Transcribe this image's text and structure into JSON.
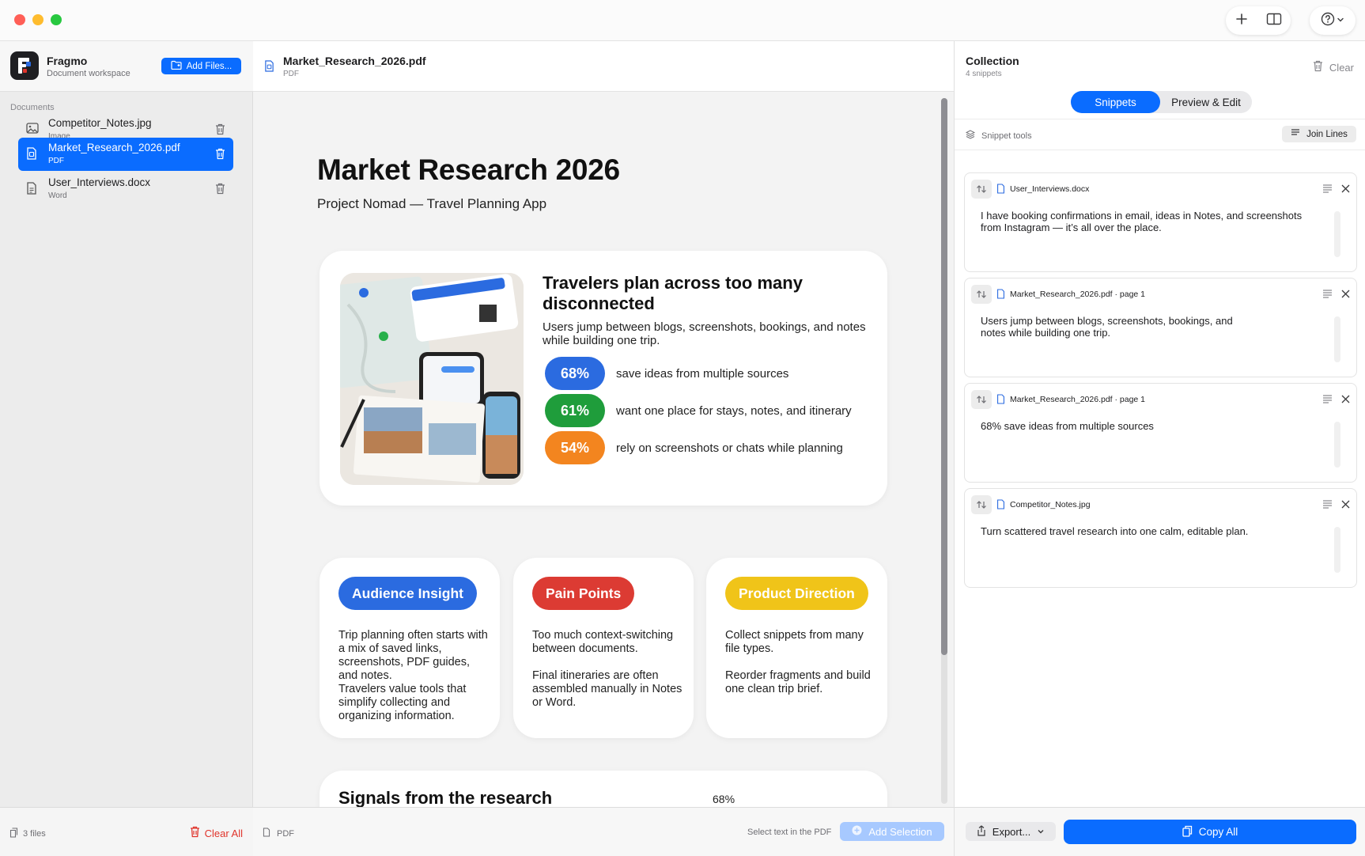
{
  "app": {
    "name": "Fragmo",
    "subtitle": "Document workspace",
    "add_files_label": "Add Files..."
  },
  "sidebar": {
    "section_label": "Documents",
    "documents": [
      {
        "name": "Competitor_Notes.jpg",
        "type": "Image",
        "icon": "image-icon",
        "selected": false
      },
      {
        "name": "Market_Research_2026.pdf",
        "type": "PDF",
        "icon": "pdf-icon",
        "selected": true
      },
      {
        "name": "User_Interviews.docx",
        "type": "Word",
        "icon": "doc-icon",
        "selected": false
      }
    ],
    "footer": {
      "files_count": "3 files",
      "clear_all_label": "Clear All"
    }
  },
  "viewer": {
    "file_name": "Market_Research_2026.pdf",
    "file_type": "PDF",
    "page": {
      "title": "Market Research 2026",
      "subtitle": "Project Nomad — Travel Planning App",
      "hero": {
        "title": "Travelers plan across too many disconnected",
        "description": "Users jump between blogs, screenshots, bookings, and notes while building one trip.",
        "stats": [
          {
            "value": "68%",
            "text": "save ideas from multiple sources",
            "color": "#2b6be0"
          },
          {
            "value": "61%",
            "text": "want one place for stays, notes, and itinerary",
            "color": "#1f9d3b"
          },
          {
            "value": "54%",
            "text": "rely on screenshots or chats while planning",
            "color": "#f3851f"
          }
        ]
      },
      "features": [
        {
          "title": "Audience Insight",
          "color": "#2b6be0",
          "body": "Trip planning often starts with a mix of saved links, screenshots, PDF guides, and notes.\nTravelers value tools that simplify collecting and organizing information."
        },
        {
          "title": "Pain Points",
          "color": "#dc3b33",
          "body": "Too much context-switching between documents.\n\nFinal itineraries are often assembled manually in Notes or Word."
        },
        {
          "title": "Product Direction",
          "color": "#f0c419",
          "body": "Collect snippets from many file types.\n\nReorder fragments and build one clean trip brief."
        }
      ],
      "signals": {
        "title": "Signals from the research",
        "value": "68%"
      }
    },
    "footer": {
      "type": "PDF",
      "hint": "Select text in the PDF",
      "add_selection_label": "Add Selection"
    }
  },
  "collection": {
    "title": "Collection",
    "count": "4 snippets",
    "clear_label": "Clear",
    "tabs": [
      {
        "label": "Snippets",
        "active": true
      },
      {
        "label": "Preview & Edit",
        "active": false
      }
    ],
    "tools_label": "Snippet tools",
    "join_lines_label": "Join Lines",
    "snippets": [
      {
        "source": "User_Interviews.docx",
        "text": "I have booking confirmations in email, ideas in Notes, and screenshots from Instagram — it’s all over the place."
      },
      {
        "source": "Market_Research_2026.pdf · page 1",
        "text": "Users jump between blogs, screenshots, bookings, and notes while building one trip."
      },
      {
        "source": "Market_Research_2026.pdf · page 1",
        "text": "68% save ideas from multiple sources"
      },
      {
        "source": "Competitor_Notes.jpg",
        "text": "Turn scattered travel research into one calm, editable plan."
      }
    ],
    "footer": {
      "export_label": "Export...",
      "copy_all_label": "Copy All"
    }
  },
  "colors": {
    "accent": "#0a6cff",
    "danger": "#e0342b"
  }
}
